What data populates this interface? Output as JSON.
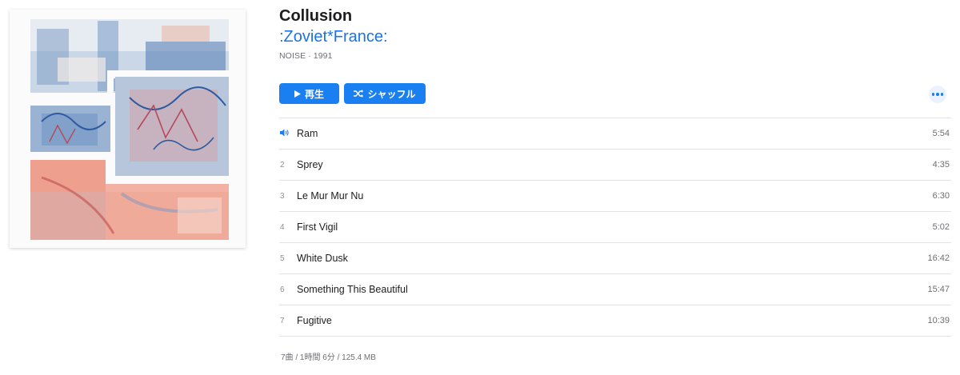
{
  "album": {
    "title": "Collusion",
    "artist": ":Zoviet*France:",
    "meta": "NOISE · 1991"
  },
  "actions": {
    "play_label": "再生",
    "play_icon": "play-triangle",
    "shuffle_label": "シャッフル",
    "shuffle_icon": "shuffle-arrows",
    "more_icon": "ellipsis",
    "accent_color": "#1a7ff0"
  },
  "tracks": [
    {
      "number": "",
      "now_playing_icon": "speaker-icon",
      "title": "Ram",
      "duration": "5:54"
    },
    {
      "number": "2",
      "title": "Sprey",
      "duration": "4:35"
    },
    {
      "number": "3",
      "title": "Le Mur Mur Nu",
      "duration": "6:30"
    },
    {
      "number": "4",
      "title": "First Vigil",
      "duration": "5:02"
    },
    {
      "number": "5",
      "title": "White Dusk",
      "duration": "16:42"
    },
    {
      "number": "6",
      "title": "Something This Beautiful",
      "duration": "15:47"
    },
    {
      "number": "7",
      "title": "Fugitive",
      "duration": "10:39"
    }
  ],
  "footer": {
    "summary": "7曲 / 1時間 6分 / 125.4 MB"
  }
}
